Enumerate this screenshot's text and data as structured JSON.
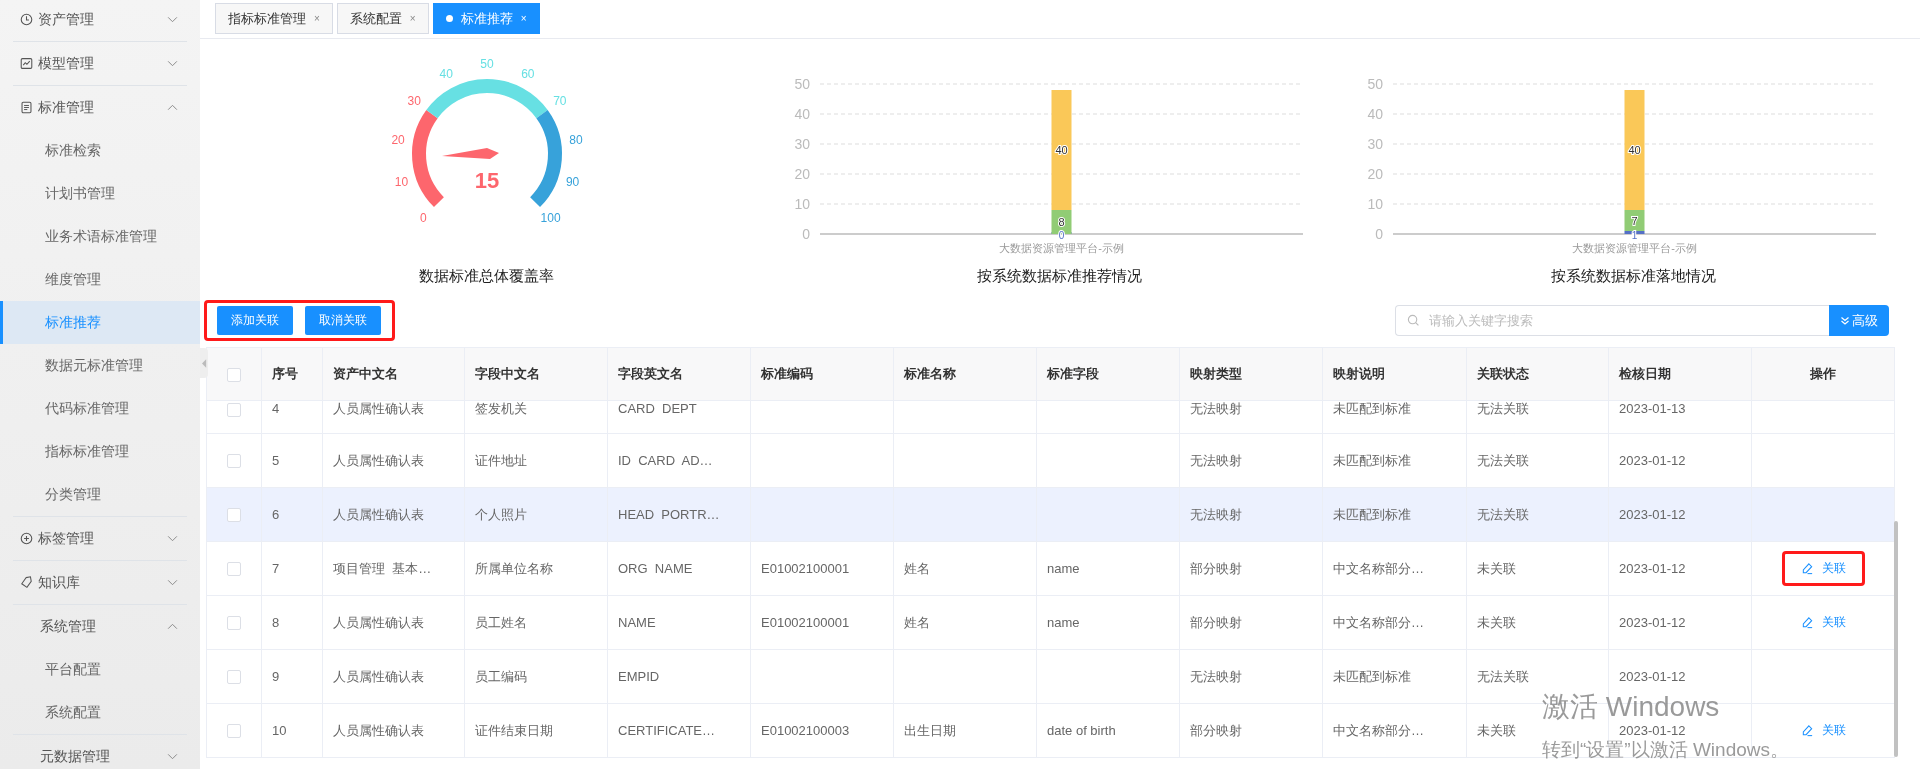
{
  "sidebar": {
    "groups": [
      {
        "label": "资产管理",
        "kind": "group",
        "expanded": false
      },
      {
        "label": "模型管理",
        "kind": "group",
        "expanded": false
      },
      {
        "label": "标准管理",
        "kind": "group",
        "expanded": true,
        "children": [
          {
            "label": "标准检索",
            "selected": false
          },
          {
            "label": "计划书管理",
            "selected": false
          },
          {
            "label": "业务术语标准管理",
            "selected": false
          },
          {
            "label": "维度管理",
            "selected": false
          },
          {
            "label": "标准推荐",
            "selected": true
          },
          {
            "label": "数据元标准管理",
            "selected": false
          },
          {
            "label": "代码标准管理",
            "selected": false
          },
          {
            "label": "指标标准管理",
            "selected": false
          },
          {
            "label": "分类管理",
            "selected": false
          }
        ]
      },
      {
        "label": "标签管理",
        "kind": "group",
        "expanded": false
      },
      {
        "label": "知识库",
        "kind": "group",
        "expanded": false
      },
      {
        "label": "系统管理",
        "kind": "subgroup",
        "expanded": true,
        "children": [
          {
            "label": "平台配置",
            "selected": false
          },
          {
            "label": "系统配置",
            "selected": false
          }
        ]
      },
      {
        "label": "元数据管理",
        "kind": "subgroup",
        "expanded": false
      }
    ]
  },
  "tabs": [
    {
      "label": "指标标准管理",
      "selected": false,
      "close": "×"
    },
    {
      "label": "系统配置",
      "selected": false,
      "close": "×"
    },
    {
      "label": "标准推荐",
      "selected": true,
      "close": "×"
    }
  ],
  "gauge": {
    "title": "数据标准总体覆盖率",
    "value": "15",
    "ticks": [
      "0",
      "10",
      "20",
      "30",
      "40",
      "50",
      "60",
      "70",
      "80",
      "90",
      "100"
    ]
  },
  "charts": [
    {
      "chart_data": {
        "type": "bar",
        "title": "按系统数据标准推荐情况",
        "categories": [
          "大数据资源管理平台-示例"
        ],
        "stacked": true,
        "grid": true,
        "ylim": [
          0,
          50
        ],
        "yticks": [
          0,
          10,
          20,
          30,
          40,
          50
        ],
        "data_labels": true,
        "series": [
          {
            "color": "#5470c6",
            "values": [
              0
            ]
          },
          {
            "color": "#91cc75",
            "values": [
              8
            ]
          },
          {
            "color": "#fac858",
            "values": [
              40
            ]
          }
        ]
      }
    },
    {
      "chart_data": {
        "type": "bar",
        "title": "按系统数据标准落地情况",
        "categories": [
          "大数据资源管理平台-示例"
        ],
        "stacked": true,
        "grid": true,
        "ylim": [
          0,
          50
        ],
        "yticks": [
          0,
          10,
          20,
          30,
          40,
          50
        ],
        "data_labels": true,
        "series": [
          {
            "color": "#5470c6",
            "values": [
              1
            ]
          },
          {
            "color": "#91cc75",
            "values": [
              7
            ]
          },
          {
            "color": "#fac858",
            "values": [
              40
            ]
          }
        ]
      }
    }
  ],
  "toolbar": {
    "annotated": true,
    "buttons": [
      "添加关联",
      "取消关联"
    ]
  },
  "search": {
    "placeholder": "请输入关键字搜索",
    "advanced": "高级"
  },
  "table": {
    "columns": [
      "序号",
      "资产中文名",
      "字段中文名",
      "字段英文名",
      "标准编码",
      "标准名称",
      "标准字段",
      "映射类型",
      "映射说明",
      "关联状态",
      "检核日期",
      "操作"
    ],
    "header_checked": false,
    "rows": [
      {
        "checked": false,
        "highlighted": false,
        "no": "4",
        "asset": "人员属性确认表",
        "field_cn": "签发机关",
        "field_en": "CARD  DEPT",
        "map_type": "无法映射",
        "map_desc": "未匹配到标准",
        "status": "无法关联",
        "date": "2023-01-13"
      },
      {
        "checked": false,
        "highlighted": false,
        "no": "5",
        "asset": "人员属性确认表",
        "field_cn": "证件地址",
        "field_en": "ID  CARD  AD…",
        "map_type": "无法映射",
        "map_desc": "未匹配到标准",
        "status": "无法关联",
        "date": "2023-01-12"
      },
      {
        "checked": false,
        "highlighted": true,
        "no": "6",
        "asset": "人员属性确认表",
        "field_cn": "个人照片",
        "field_en": "HEAD  PORTR…",
        "map_type": "无法映射",
        "map_desc": "未匹配到标准",
        "status": "无法关联",
        "date": "2023-01-12"
      },
      {
        "checked": false,
        "highlighted": false,
        "no": "7",
        "asset": "项目管理  基本…",
        "field_cn": "所属单位名称",
        "field_en": "ORG  NAME",
        "std_code": "E01002100001",
        "std_name": "姓名",
        "std_field": "name",
        "map_type": "部分映射",
        "map_desc": "中文名称部分…",
        "status": "未关联",
        "date": "2023-01-12",
        "action": {
          "label": "关联",
          "annotated": true
        }
      },
      {
        "checked": false,
        "highlighted": false,
        "no": "8",
        "asset": "人员属性确认表",
        "field_cn": "员工姓名",
        "field_en": "NAME",
        "std_code": "E01002100001",
        "std_name": "姓名",
        "std_field": "name",
        "map_type": "部分映射",
        "map_desc": "中文名称部分…",
        "status": "未关联",
        "date": "2023-01-12",
        "action": {
          "label": "关联",
          "annotated": false
        }
      },
      {
        "checked": false,
        "highlighted": false,
        "no": "9",
        "asset": "人员属性确认表",
        "field_cn": "员工编码",
        "field_en": "EMPID",
        "map_type": "无法映射",
        "map_desc": "未匹配到标准",
        "status": "无法关联",
        "date": "2023-01-12"
      },
      {
        "checked": false,
        "highlighted": false,
        "no": "10",
        "asset": "人员属性确认表",
        "field_cn": "证件结束日期",
        "field_en": "CERTIFICATE…",
        "std_code": "E01002100003",
        "std_name": "出生日期",
        "std_field": "date of birth",
        "map_type": "部分映射",
        "map_desc": "中文名称部分…",
        "status": "未关联",
        "date": "2023-01-12",
        "action": {
          "label": "关联",
          "annotated": false
        }
      }
    ]
  },
  "os_notice": {
    "title": "激活 Windows",
    "subtitle": "转到“设置”以激活 Windows。"
  }
}
